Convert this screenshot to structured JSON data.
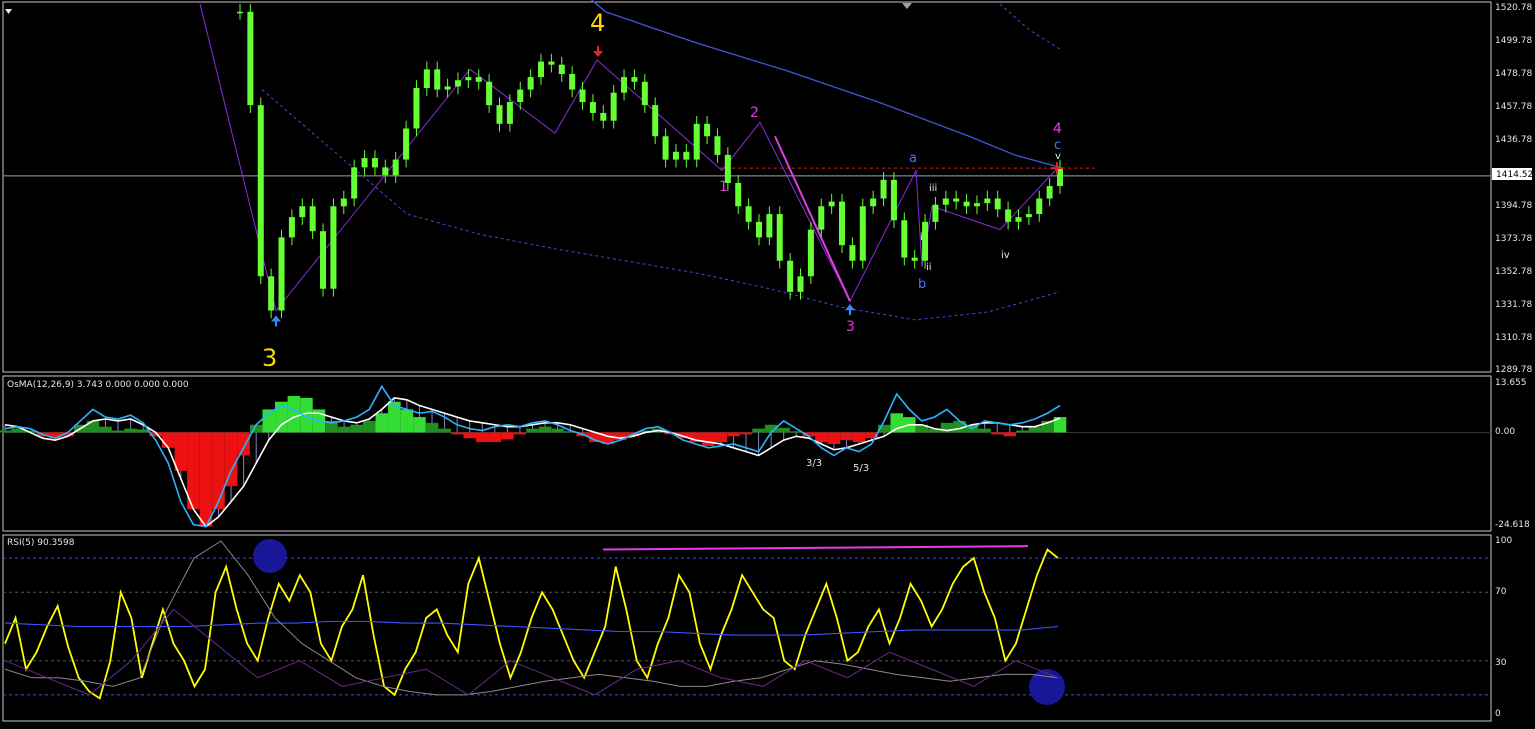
{
  "colors": {
    "background": "#000000",
    "frame": "#c8c8c8",
    "candle": "#66ff33",
    "ma_solid": "#3f57d9",
    "envelope": "#3a4fd8",
    "wave_line": "#8a2be2",
    "resistance": "#d02020",
    "price_line": "#9aa3b5",
    "osma_up_strong": "#33dd33",
    "osma_up_weak": "#1f8f1f",
    "osma_down": "#ee1111",
    "macd_line": "#ffffff",
    "signal_line": "#2ab4ff",
    "rsi_line": "#ffff00",
    "rsi_ma": "#3d55ff",
    "magenta": "#e23ce6",
    "highlight_circle": "#1a1aa8",
    "arrow_up": "#2d8cff",
    "arrow_down": "#ee2222"
  },
  "price_panel": {
    "current_price": "1414.52",
    "resistance_level": 1419.5,
    "axis_ticks": [
      "1520.78",
      "1499.78",
      "1478.78",
      "1457.78",
      "1436.78",
      "1414.52",
      "1394.78",
      "1373.78",
      "1352.78",
      "1331.78",
      "1310.78",
      "1289.78"
    ],
    "wave_labels": {
      "big_3": "3",
      "big_4": "4",
      "mag_1": "1",
      "mag_2": "2",
      "mag_3": "3",
      "mag_4": "4",
      "blue_a": "a",
      "blue_b": "b",
      "blue_c": "c",
      "white_i": "i",
      "white_ii": "ii",
      "white_iii": "iii",
      "white_iv": "iv",
      "white_v": "v"
    }
  },
  "osma_panel": {
    "title": "OsMA(12,26,9) 3.743 0.000 0.000 0.000",
    "axis_ticks": [
      "13.655",
      "0.00",
      "-24.618"
    ],
    "annotations": [
      "3/3",
      "5/3"
    ]
  },
  "rsi_panel": {
    "title": "RSI(5) 90.3598",
    "axis_ticks": [
      "100",
      "70",
      "30",
      "0"
    ]
  },
  "chart_data": [
    {
      "type": "candlestick",
      "panel": "price",
      "ylim": [
        1289.78,
        1525
      ],
      "ma_values": [
        1545,
        1520,
        1510,
        1500,
        1491,
        1482,
        1472,
        1462,
        1451,
        1440,
        1428,
        1420
      ],
      "upper_band": [
        1525,
        1508,
        1496
      ],
      "lower_band": [
        1470,
        1430,
        1390,
        1377,
        1368,
        1360,
        1352,
        1342,
        1330,
        1322,
        1327,
        1340
      ],
      "wave_path": [
        1525,
        1328,
        1483,
        1442,
        1489,
        1418,
        1449,
        1334,
        1418,
        1356,
        1395,
        1380,
        1420
      ],
      "values": [
        1520,
        1460,
        1350,
        1328,
        1375,
        1388,
        1395,
        1379,
        1342,
        1395,
        1400,
        1420,
        1426,
        1420,
        1415,
        1425,
        1445,
        1471,
        1483,
        1470,
        1472,
        1476,
        1478,
        1475,
        1460,
        1448,
        1462,
        1470,
        1478,
        1488,
        1486,
        1480,
        1470,
        1462,
        1455,
        1450,
        1468,
        1478,
        1475,
        1460,
        1440,
        1425,
        1430,
        1425,
        1448,
        1440,
        1428,
        1410,
        1395,
        1385,
        1375,
        1390,
        1360,
        1340,
        1350,
        1380,
        1395,
        1398,
        1370,
        1360,
        1395,
        1400,
        1412,
        1386,
        1362,
        1360,
        1385,
        1396,
        1400,
        1398,
        1395,
        1397,
        1400,
        1393,
        1385,
        1388,
        1390,
        1400,
        1408,
        1420
      ]
    },
    {
      "type": "histogram",
      "panel": "osma",
      "ylim": [
        -24.618,
        13.655
      ],
      "histogram": [
        0.5,
        1.0,
        0.5,
        -1.0,
        -1.5,
        -1.0,
        2.0,
        3.0,
        1.5,
        0.5,
        1.0,
        0.8,
        -1.0,
        -4.0,
        -10.0,
        -20.0,
        -24.5,
        -20.0,
        -14.0,
        -6.0,
        2.0,
        6.0,
        8.0,
        9.5,
        9.0,
        6.0,
        3.0,
        1.5,
        2.0,
        3.0,
        5.0,
        8.0,
        6.0,
        4.0,
        2.5,
        1.0,
        -0.5,
        -1.5,
        -2.5,
        -2.5,
        -1.8,
        -0.5,
        1.0,
        1.5,
        1.0,
        0.3,
        -1.0,
        -2.5,
        -3.0,
        -2.0,
        -1.0,
        0.5,
        1.0,
        -0.5,
        -1.5,
        -2.5,
        -3.5,
        -2.5,
        -1.0,
        -0.5,
        1.0,
        2.0,
        1.2,
        0.3,
        -1.0,
        -2.5,
        -3.0,
        -2.0,
        -2.5,
        -1.5,
        2.0,
        5.0,
        4.0,
        2.0,
        1.0,
        2.5,
        3.0,
        2.0,
        1.0,
        -0.5,
        -1.0,
        0.5,
        1.5,
        3.0,
        4.0
      ],
      "macd": [
        2.0,
        1.5,
        0.0,
        -1.5,
        -2.0,
        -1.0,
        1.0,
        3.0,
        3.5,
        3.0,
        3.5,
        2.0,
        0.0,
        -4.0,
        -12.0,
        -20.0,
        -24.5,
        -22.0,
        -18.0,
        -14.0,
        -8.0,
        -2.0,
        2.0,
        4.0,
        5.0,
        5.0,
        4.0,
        3.0,
        2.5,
        3.5,
        6.0,
        9.0,
        8.5,
        7.0,
        6.0,
        5.0,
        4.0,
        3.0,
        2.5,
        2.0,
        1.5,
        1.5,
        2.0,
        2.5,
        2.5,
        2.0,
        1.0,
        0.0,
        -1.0,
        -1.5,
        -1.0,
        0.0,
        0.5,
        0.0,
        -1.0,
        -2.0,
        -2.5,
        -3.0,
        -4.0,
        -5.0,
        -6.0,
        -4.0,
        -2.0,
        -1.0,
        -1.5,
        -3.0,
        -4.5,
        -4.0,
        -3.0,
        -2.0,
        -1.0,
        1.0,
        2.0,
        2.0,
        1.0,
        0.5,
        1.0,
        2.0,
        2.5,
        2.5,
        2.0,
        1.5,
        1.5,
        2.5,
        3.743
      ],
      "signal": [
        1.0,
        1.5,
        1.0,
        -0.5,
        -1.5,
        0.0,
        3.0,
        6.0,
        4.0,
        3.5,
        4.5,
        2.5,
        -2.0,
        -8.0,
        -18.0,
        -24.0,
        -24.5,
        -18.0,
        -10.0,
        -4.0,
        2.0,
        5.0,
        7.0,
        6.0,
        4.0,
        3.0,
        2.5,
        3.0,
        4.0,
        6.0,
        12.0,
        7.0,
        6.0,
        5.0,
        5.5,
        4.0,
        2.0,
        1.0,
        0.5,
        1.5,
        2.0,
        1.5,
        2.5,
        3.0,
        2.0,
        0.5,
        -0.5,
        -2.0,
        -3.0,
        -2.0,
        -0.5,
        1.0,
        1.5,
        0.0,
        -2.0,
        -3.0,
        -4.0,
        -3.5,
        -3.0,
        -4.0,
        -5.0,
        0.0,
        3.0,
        1.0,
        -1.0,
        -4.0,
        -6.0,
        -4.0,
        -5.0,
        -3.0,
        3.0,
        10.0,
        6.0,
        3.0,
        4.0,
        6.0,
        3.0,
        1.0,
        3.0,
        2.5,
        2.0,
        2.5,
        3.5,
        5.0,
        7.0
      ]
    },
    {
      "type": "line",
      "panel": "rsi",
      "ylim": [
        0,
        100
      ],
      "levels": [
        90,
        70,
        30,
        10
      ],
      "series": [
        {
          "values": [
            40,
            55,
            25,
            35,
            50,
            62,
            38,
            20,
            12,
            8,
            30,
            70,
            55,
            20,
            40,
            60,
            40,
            30,
            15,
            25,
            70,
            85,
            60,
            40,
            30,
            55,
            75,
            65,
            80,
            70,
            40,
            30,
            50,
            60,
            80,
            45,
            15,
            10,
            25,
            35,
            55,
            60,
            45,
            35,
            75,
            90,
            65,
            40,
            20,
            35,
            55,
            70,
            60,
            45,
            30,
            20,
            35,
            50,
            85,
            60,
            30,
            20,
            40,
            55,
            80,
            70,
            40,
            25,
            45,
            60,
            80,
            70,
            60,
            55,
            30,
            25,
            45,
            60,
            75,
            55,
            30,
            35,
            50,
            60,
            40,
            55,
            75,
            65,
            50,
            60,
            75,
            85,
            90,
            70,
            55,
            30,
            40,
            60,
            80,
            95,
            90
          ]
        },
        {
          "values": [
            52,
            51,
            50,
            50,
            50,
            50,
            51,
            52,
            52,
            53,
            53,
            52,
            52,
            51,
            50,
            49,
            48,
            47,
            47,
            46,
            45,
            45,
            45,
            46,
            47,
            48,
            48,
            48,
            48,
            50
          ]
        },
        {
          "values": [
            25,
            20,
            20,
            18,
            15,
            20,
            60,
            90,
            100,
            80,
            55,
            40,
            30,
            20,
            15,
            12,
            10,
            10,
            12,
            15,
            18,
            20,
            22,
            20,
            18,
            15,
            15,
            18,
            20,
            25,
            30,
            28,
            25,
            22,
            20,
            18,
            20,
            22,
            22,
            20
          ]
        },
        {
          "values": [
            30,
            20,
            10,
            30,
            60,
            40,
            20,
            30,
            15,
            20,
            25,
            10,
            30,
            20,
            10,
            25,
            30,
            20,
            15,
            30,
            20,
            35,
            25,
            15,
            30,
            20
          ]
        }
      ],
      "trendline": [
        95,
        97
      ]
    }
  ]
}
